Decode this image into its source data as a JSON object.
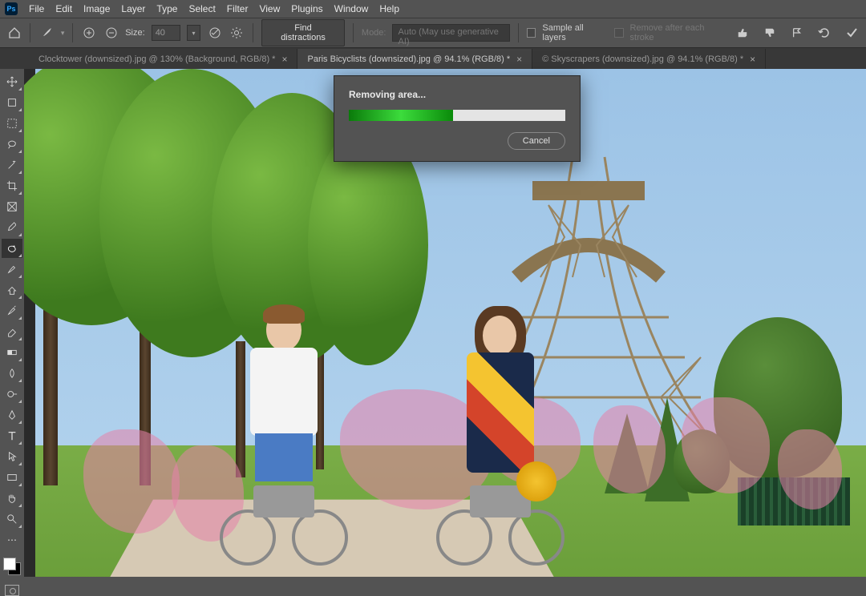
{
  "app": {
    "logo": "Ps"
  },
  "menu": [
    "File",
    "Edit",
    "Image",
    "Layer",
    "Type",
    "Select",
    "Filter",
    "View",
    "Plugins",
    "Window",
    "Help"
  ],
  "options": {
    "size_label": "Size:",
    "size_value": "40",
    "find_distractions": "Find distractions",
    "mode_label": "Mode:",
    "mode_value": "Auto (May use generative AI)",
    "sample_all": "Sample all layers",
    "remove_after": "Remove after each stroke"
  },
  "tabs": [
    {
      "label": "Clocktower (downsized).jpg @ 130% (Background, RGB/8) *",
      "active": false
    },
    {
      "label": "Paris Bicyclists (downsized).jpg @ 94.1% (RGB/8) *",
      "active": true
    },
    {
      "label": "© Skyscrapers (downsized).jpg @ 94.1% (RGB/8) *",
      "active": false
    }
  ],
  "dialog": {
    "title": "Removing area...",
    "cancel": "Cancel",
    "progress_pct": 48
  },
  "tools": [
    "move",
    "artboard",
    "marquee",
    "lasso",
    "wand",
    "crop",
    "frame",
    "eyedropper",
    "spot-heal",
    "brush",
    "clone",
    "history-brush",
    "eraser",
    "gradient",
    "blur",
    "dodge",
    "pen",
    "type",
    "path-select",
    "rectangle",
    "hand",
    "zoom"
  ]
}
